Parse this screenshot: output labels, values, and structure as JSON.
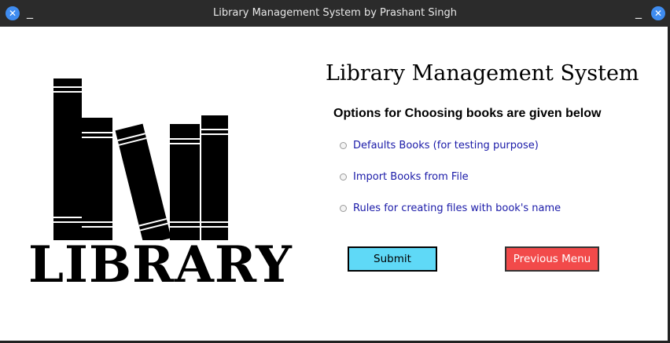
{
  "window": {
    "title": "Library Management System by Prashant Singh"
  },
  "logo": {
    "word": "LIBRARY"
  },
  "main": {
    "heading": "Library Management System",
    "subheading": "Options for Choosing books are given below",
    "options": [
      {
        "label": "Defaults Books (for testing purpose)"
      },
      {
        "label": "Import Books from File"
      },
      {
        "label": "Rules for creating files with book's name"
      }
    ],
    "submit_label": "Submit",
    "previous_label": "Previous Menu"
  },
  "colors": {
    "titlebar": "#2b2b2b",
    "submit_bg": "#5fd9f7",
    "previous_bg": "#f24a4a",
    "option_text": "#1a1aa8",
    "window_icon": "#3f8cf0"
  }
}
